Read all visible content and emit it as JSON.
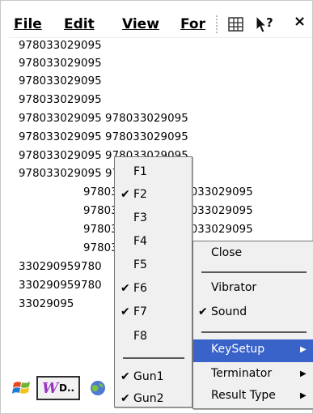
{
  "menubar": {
    "file": "File",
    "edit": "Edit",
    "view": "View",
    "format": "For",
    "close": "×"
  },
  "content": {
    "lines": [
      "978033029095",
      "978033029095",
      "978033029095",
      "978033029095",
      "978033029095 978033029095",
      "978033029095 978033029095",
      "978033029095 978033029095",
      "978033029095 978033029095",
      "978033029095 978033029095",
      "978033029095 978033029095",
      "978033029095 978033029095",
      "978033029095 978033029095",
      "330290959780",
      "330290959780",
      "33029095"
    ]
  },
  "taskbar": {
    "button_label": "D.."
  },
  "fkey_menu": {
    "items": [
      {
        "label": "F1",
        "checked": false
      },
      {
        "label": "F2",
        "checked": true
      },
      {
        "label": "F3",
        "checked": false
      },
      {
        "label": "F4",
        "checked": false
      },
      {
        "label": "F5",
        "checked": false
      },
      {
        "label": "F6",
        "checked": true
      },
      {
        "label": "F7",
        "checked": true
      },
      {
        "label": "F8",
        "checked": false
      },
      {
        "label": "Gun1",
        "checked": true
      },
      {
        "label": "Gun2",
        "checked": true
      }
    ]
  },
  "main_menu": {
    "items": [
      {
        "label": "Close",
        "checked": false
      },
      {
        "label": "Vibrator",
        "checked": false
      },
      {
        "label": "Sound",
        "checked": true
      },
      {
        "label": "KeySetup",
        "submenu": true,
        "highlighted": true
      },
      {
        "label": "Terminator",
        "submenu": true
      },
      {
        "label": "Result Type",
        "submenu": true
      }
    ]
  },
  "check_glyph": "✔",
  "arrow_glyph": "▶",
  "colors": {
    "highlight": "#3a63c9",
    "menu_bg": "#f0f0f0"
  },
  "icons": {
    "start": "windows-flag-icon",
    "app": "w-app-icon",
    "keyboard": "keyboard-icon",
    "help": "whats-this-help-icon"
  }
}
